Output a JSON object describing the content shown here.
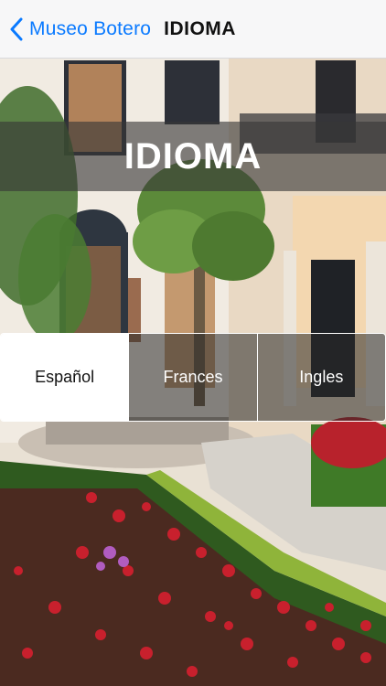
{
  "navbar": {
    "back_label": "Museo Botero",
    "title": "IDIOMA"
  },
  "hero": {
    "title": "IDIOMA"
  },
  "languages": {
    "selected": "Español",
    "options": [
      "Español",
      "Frances",
      "Ingles"
    ]
  },
  "colors": {
    "accent": "#0a7aff",
    "overlay": "#373737"
  }
}
